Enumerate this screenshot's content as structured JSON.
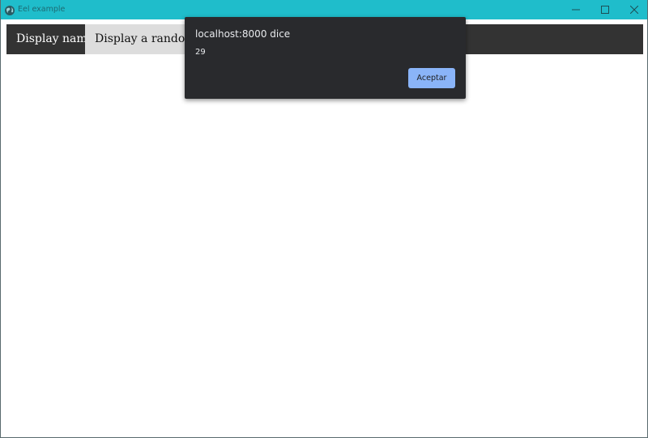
{
  "window": {
    "title": "Eel example",
    "app_icon": "globe-icon",
    "controls": [
      "minimize-icon",
      "maximize-icon",
      "close-icon"
    ],
    "titlebar_color": "#1fbdcb"
  },
  "nav": {
    "tabs": [
      {
        "label": "Display name",
        "active": true
      },
      {
        "label": "Display a random number",
        "active": false
      }
    ]
  },
  "dialog": {
    "title": "localhost:8000 dice",
    "message": "29",
    "ok_label": "Aceptar",
    "accent_color": "#8ab4f8",
    "background_color": "#292a2d"
  }
}
